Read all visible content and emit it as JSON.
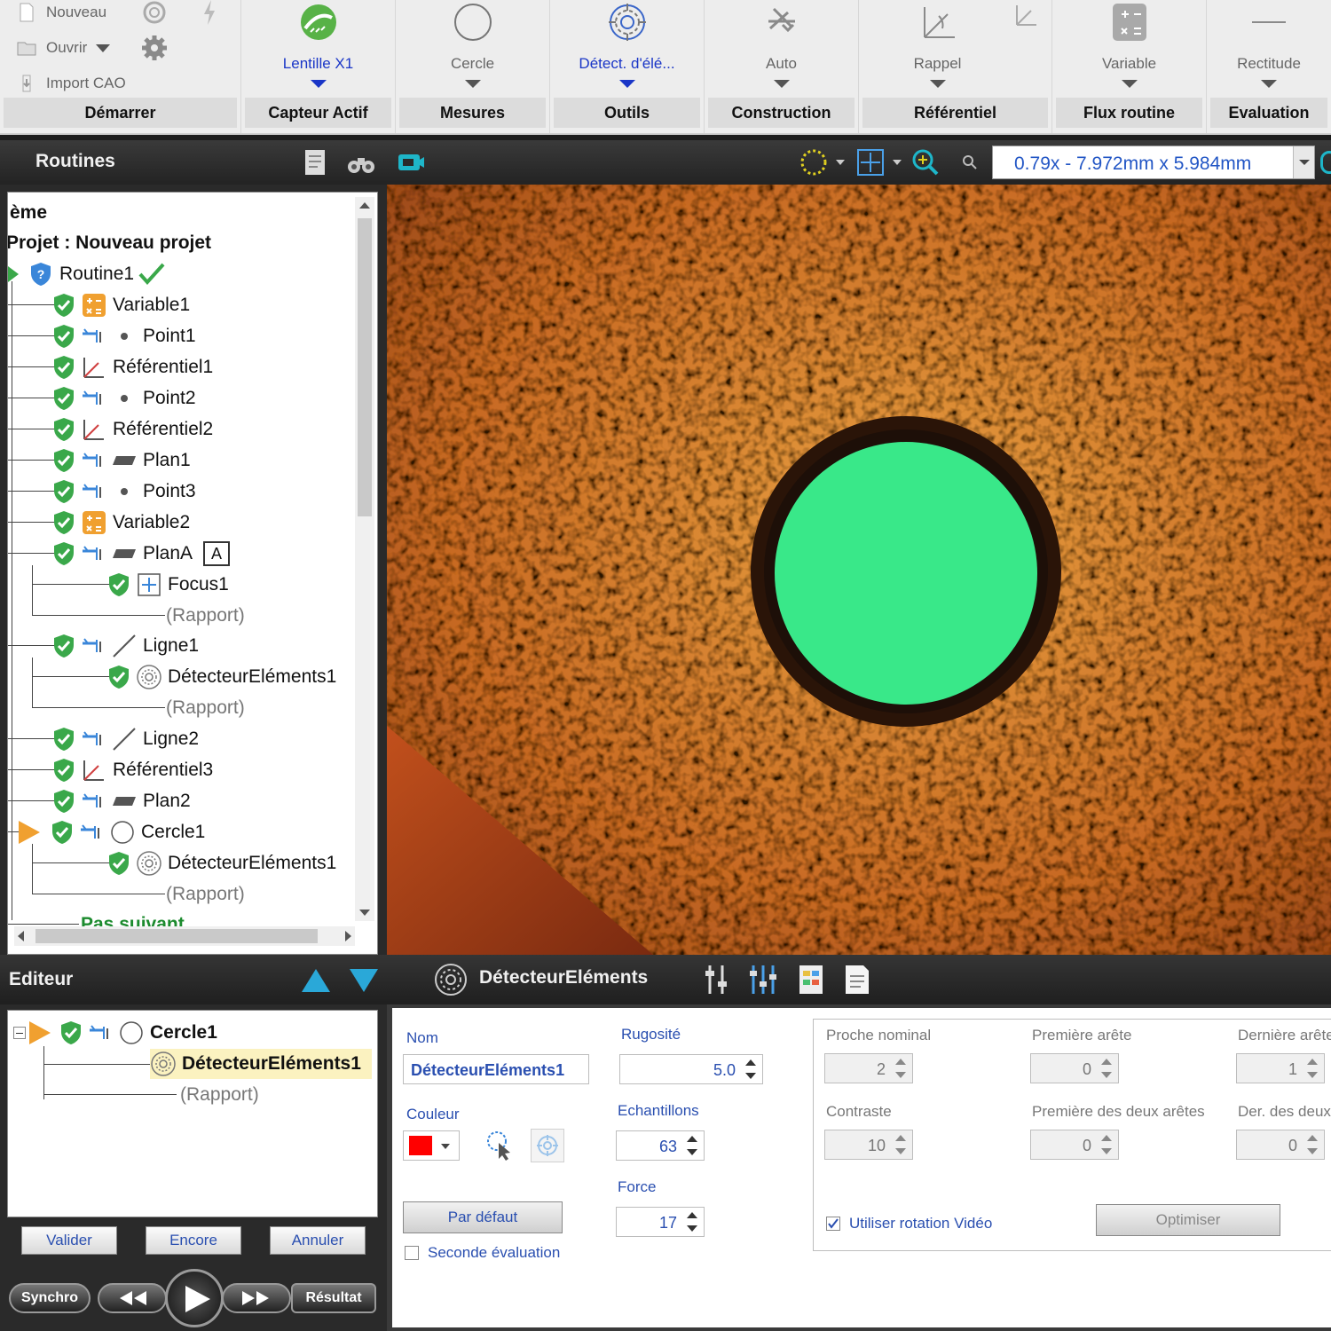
{
  "ribbon": {
    "start": {
      "new_label": "Nouveau",
      "open_label": "Ouvrir",
      "import_label": "Import CAO",
      "group_label": "Démarrer"
    },
    "groups": [
      {
        "button": "Lentille X1",
        "group": "Capteur Actif"
      },
      {
        "button": "Cercle",
        "group": "Mesures"
      },
      {
        "button": "Détect. d'élé...",
        "group": "Outils"
      },
      {
        "button": "Auto",
        "group": "Construction"
      },
      {
        "button": "Rappel",
        "group": "Référentiel"
      },
      {
        "button": "Variable",
        "group": "Flux routine"
      },
      {
        "button": "Rectitude",
        "group": "Evaluation"
      }
    ]
  },
  "routines_bar": {
    "title": "Routines",
    "zoom_value": "0.79x - 7.972mm x 5.984mm"
  },
  "tree": {
    "root_partial": "ème",
    "project": "Projet : Nouveau projet",
    "items": [
      {
        "label": "Routine1"
      },
      {
        "label": "Variable1"
      },
      {
        "label": "Point1"
      },
      {
        "label": "Référentiel1"
      },
      {
        "label": "Point2"
      },
      {
        "label": "Référentiel2"
      },
      {
        "label": "Plan1"
      },
      {
        "label": "Point3"
      },
      {
        "label": "Variable2"
      },
      {
        "label": "PlanA",
        "tag": "A"
      },
      {
        "label": "Focus1"
      },
      {
        "label": "(Rapport)"
      },
      {
        "label": "Ligne1"
      },
      {
        "label": "DétecteurEléments1"
      },
      {
        "label": "(Rapport)"
      },
      {
        "label": "Ligne2"
      },
      {
        "label": "Référentiel3"
      },
      {
        "label": "Plan2"
      },
      {
        "label": "Cercle1"
      },
      {
        "label": "DétecteurEléments1"
      },
      {
        "label": "(Rapport)"
      },
      {
        "label": "Pas suivant"
      }
    ]
  },
  "editor": {
    "title": "Editeur",
    "tool_title": "DétecteurEléments",
    "tree": [
      {
        "label": "Cercle1"
      },
      {
        "label": "DétecteurEléments1"
      },
      {
        "label": "(Rapport)"
      }
    ],
    "buttons": {
      "validate": "Valider",
      "again": "Encore",
      "cancel": "Annuler"
    },
    "playback": {
      "sync": "Synchro",
      "result": "Résultat"
    }
  },
  "props": {
    "name_label": "Nom",
    "name_value": "DétecteurEléments1",
    "color_label": "Couleur",
    "color_value": "#ff0000",
    "default_button": "Par défaut",
    "second_eval_label": "Seconde évaluation",
    "second_eval_checked": false,
    "roughness_label": "Rugosité",
    "roughness_value": "5.0",
    "samples_label": "Echantillons",
    "samples_value": "63",
    "force_label": "Force",
    "force_value": "17",
    "nearest_label": "Proche nominal",
    "nearest_value": "2",
    "first_edge_label": "Première arête",
    "first_edge_value": "0",
    "last_edge_label": "Dernière arête",
    "last_edge_value": "1",
    "contrast_label": "Contraste",
    "contrast_value": "10",
    "first_two_label": "Première des deux arêtes",
    "first_two_value": "0",
    "last_two_label": "Der. des deux",
    "last_two_value": "0",
    "video_rotation_label": "Utiliser rotation Vidéo",
    "video_rotation_checked": true,
    "optimize_button": "Optimiser"
  },
  "colors": {
    "accent_blue": "#1a36c7",
    "check_green": "#3aa84a",
    "feature_green": "#39e889",
    "play_orange": "#f0a030"
  }
}
